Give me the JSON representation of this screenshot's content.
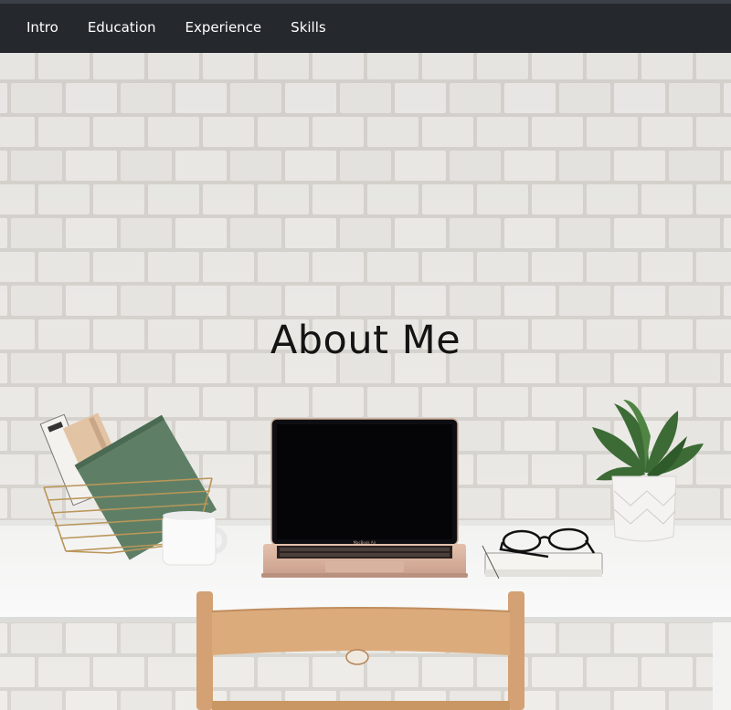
{
  "nav": {
    "items": [
      {
        "label": "Intro"
      },
      {
        "label": "Education"
      },
      {
        "label": "Experience"
      },
      {
        "label": "Skills"
      }
    ]
  },
  "hero": {
    "title": "About Me",
    "laptop_brand": "MacBook Air"
  },
  "colors": {
    "navbar_bg": "#25292e",
    "nav_text": "#ffffff",
    "wall": "#ebe9e5",
    "desk": "#f5f5f5",
    "chair_wood": "#d9a878",
    "book_green": "#5a7c63",
    "plant_green": "#3c6b35"
  }
}
